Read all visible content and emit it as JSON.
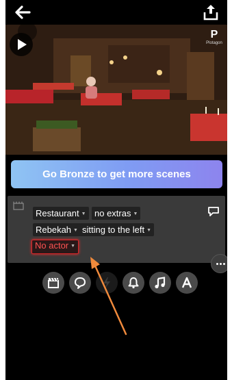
{
  "app": {
    "watermark_letter": "P",
    "watermark_text": "Plotagon"
  },
  "upsell": {
    "label": "Go Bronze to get more scenes"
  },
  "scene_panel": {
    "location": "Restaurant",
    "extras": "no extras",
    "character": "Rebekah",
    "position": "sitting to the left",
    "actor": "No actor"
  },
  "toolbar": {
    "items": [
      {
        "icon": "clapperboard-icon",
        "enabled": true
      },
      {
        "icon": "speech-bubble-icon",
        "enabled": true
      },
      {
        "icon": "lightning-icon",
        "enabled": false
      },
      {
        "icon": "bell-icon",
        "enabled": true
      },
      {
        "icon": "music-note-icon",
        "enabled": true
      },
      {
        "icon": "text-a-icon",
        "enabled": true
      }
    ]
  },
  "colors": {
    "annotation_arrow": "#f08a3c",
    "warning_red": "#ff5252",
    "upsell_start": "#8fc4f3",
    "upsell_end": "#8d84ee"
  }
}
